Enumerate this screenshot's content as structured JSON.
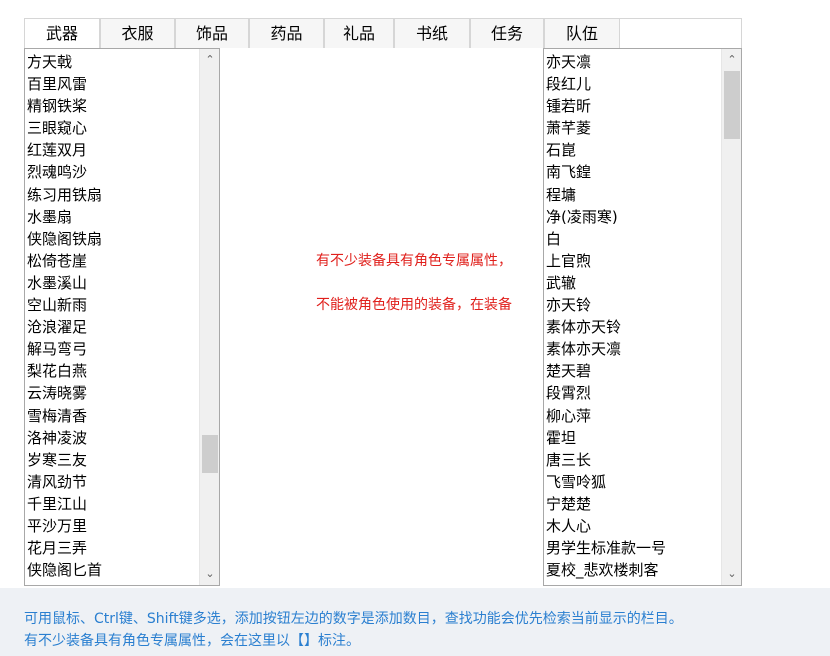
{
  "tabs": [
    "武器",
    "衣服",
    "饰品",
    "药品",
    "礼品",
    "书纸",
    "任务",
    "队伍"
  ],
  "active_tab": "武器",
  "left_list": {
    "items": [
      "方天戟",
      "百里风雷",
      "精钢铁桨",
      "三眼窥心",
      "红莲双月",
      "烈魂鸣沙",
      "练习用铁扇",
      "水墨扇",
      "侠隐阁铁扇",
      "松倚苍崖",
      "水墨溪山",
      "空山新雨",
      "沧浪濯足",
      "解马弯弓",
      "梨花白燕",
      "云涛晓雾",
      "雪梅清香",
      "洛神凌波",
      "岁寒三友",
      "清风劲节",
      "千里江山",
      "平沙万里",
      "花月三弄",
      "侠隐阁匕首"
    ],
    "scroll_position": 0.82
  },
  "right_list": {
    "items": [
      "亦天凛",
      "段红儿",
      "锺若昕",
      "萧芊菱",
      "石崑",
      "南飞鍠",
      "程墉",
      "净(凌雨寒)",
      "白",
      "上官煦",
      "武辙",
      "亦天铃",
      "素体亦天铃",
      "素体亦天凛",
      "楚天碧",
      "段霄烈",
      "柳心萍",
      "霍坦",
      "唐三长",
      "飞雪呤狐",
      "宁楚楚",
      "木人心",
      "男学生标准款一号",
      "夏校_悲欢楼刺客"
    ],
    "scroll_position": 0.0
  },
  "middle_notes": [
    "有不少装备具有角色专属属性，",
    "不能被角色使用的装备，在装备"
  ],
  "footer": {
    "line1": "可用鼠标、Ctrl键、Shift键多选，添加按钮左边的数字是添加数目，查找功能会优先检索当前显示的栏目。",
    "line2": "有不少装备具有角色专属属性，会在这里以【】标注。"
  },
  "colors": {
    "note_red": "#e0201c",
    "footer_blue": "#2a7fd0"
  }
}
